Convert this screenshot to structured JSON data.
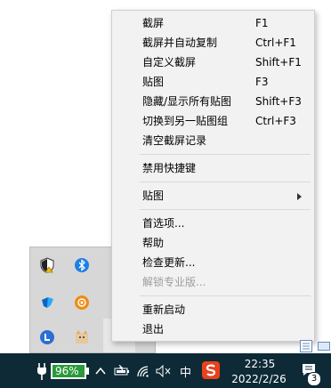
{
  "menu": {
    "items": [
      {
        "label": "截屏",
        "shortcut": "F1",
        "disabled": false
      },
      {
        "label": "截屏并自动复制",
        "shortcut": "Ctrl+F1",
        "disabled": false
      },
      {
        "label": "自定义截屏",
        "shortcut": "Shift+F1",
        "disabled": false
      },
      {
        "label": "贴图",
        "shortcut": "F3",
        "disabled": false
      },
      {
        "label": "隐藏/显示所有贴图",
        "shortcut": "Shift+F3",
        "disabled": false
      },
      {
        "label": "切换到另一贴图组",
        "shortcut": "Ctrl+F3",
        "disabled": false
      },
      {
        "label": "清空截屏记录",
        "shortcut": "",
        "disabled": false
      },
      {
        "label": "禁用快捷键",
        "shortcut": "",
        "disabled": false
      },
      {
        "label": "贴图",
        "shortcut": "",
        "submenu": true,
        "disabled": false
      },
      {
        "label": "首选项...",
        "shortcut": "",
        "disabled": false
      },
      {
        "label": "帮助",
        "shortcut": "",
        "disabled": false
      },
      {
        "label": "检查更新...",
        "shortcut": "",
        "disabled": false
      },
      {
        "label": "解锁专业版...",
        "shortcut": "",
        "disabled": true
      },
      {
        "label": "重新启动",
        "shortcut": "",
        "disabled": false
      },
      {
        "label": "退出",
        "shortcut": "",
        "disabled": false
      }
    ]
  },
  "taskbar": {
    "battery_percent": "96%",
    "ime": "中",
    "time": "22:35",
    "date": "2022/2/26",
    "notification_count": "3"
  },
  "tray": {
    "icons": [
      "shield-warning-icon",
      "bluetooth-icon",
      "app-blue-icon",
      "app-orange-icon",
      "app-l-icon",
      "cat-app-icon"
    ]
  }
}
